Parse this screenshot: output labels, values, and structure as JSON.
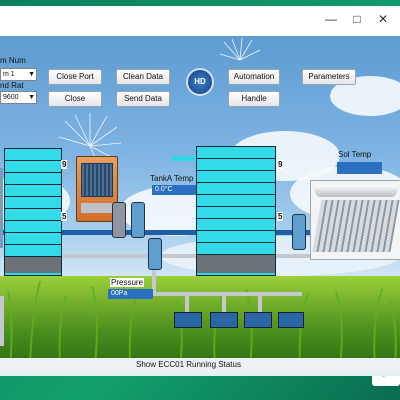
{
  "left_panel": {
    "num_label": "m Num",
    "num_value": "m 1",
    "rate_label": "nd Rat",
    "rate_value": "9600"
  },
  "buttons": {
    "close_port": "Close Port",
    "close": "Close",
    "clean_data": "Clean Data",
    "send_data": "Send Data",
    "automation": "Automation",
    "handle": "Handle",
    "parameters": "Parameters",
    "hd_badge": "HD"
  },
  "tank_left": {
    "level_marker_top": "9",
    "level_marker_mid": "5"
  },
  "tank_right": {
    "level_marker_top": "9",
    "level_marker_mid": "5"
  },
  "tank_a_temp": {
    "label": "TankA Temp",
    "value": "0.0°C"
  },
  "sol_temp": {
    "label": "Sol Temp",
    "value": ""
  },
  "pressure": {
    "label": "Pressure",
    "value": "00Pa"
  },
  "status": {
    "text": "Show ECC01 Running Status"
  },
  "watermark": {
    "text": "qc"
  },
  "colors": {
    "tank": "#2fd8e6",
    "readout": "#2a6fc2",
    "pipe": "#1f5fa8",
    "wallpaper": "#0f8a64"
  }
}
